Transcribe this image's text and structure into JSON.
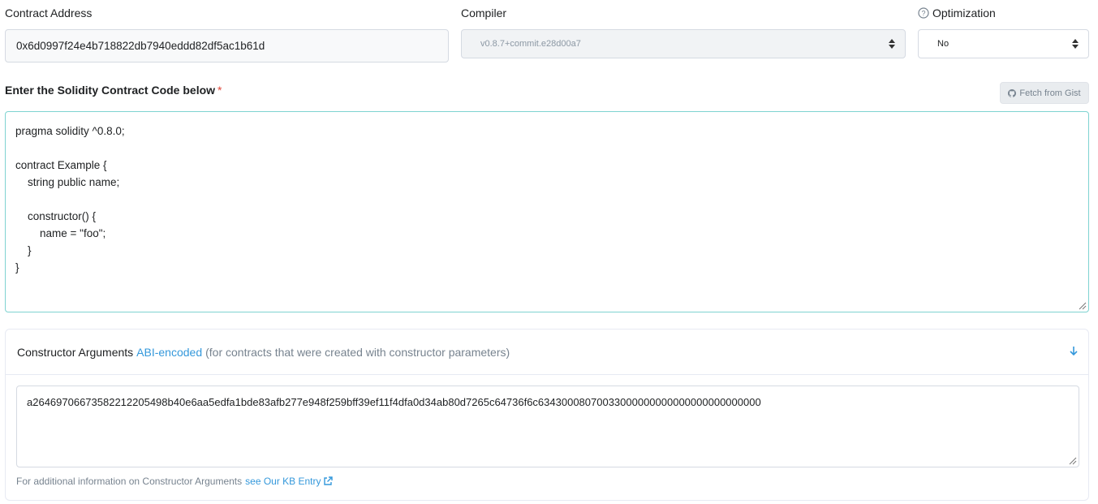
{
  "contract_address": {
    "label": "Contract Address",
    "value": "0x6d0997f24e4b718822db7940eddd82df5ac1b61d"
  },
  "compiler": {
    "label": "Compiler",
    "selected": "v0.8.7+commit.e28d00a7"
  },
  "optimization": {
    "label": "Optimization",
    "selected": "No"
  },
  "code_section": {
    "title": "Enter the Solidity Contract Code below",
    "required_marker": "*",
    "fetch_button_label": "Fetch from Gist",
    "code": "pragma solidity ^0.8.0;\n\ncontract Example {\n    string public name;\n\n    constructor() {\n        name = \"foo\";\n    }\n}"
  },
  "constructor_args": {
    "title": "Constructor Arguments",
    "link_text": "ABI-encoded",
    "hint": "(for contracts that were created with constructor parameters)",
    "value": "a264697066735822122054 98b40e6aa5edfa1bde83afb277e948f259bff39ef11f4dfa0d34ab80d7265c64736f6c63430008070033000000000000000000000000",
    "note_text": "For additional information on Constructor Arguments",
    "note_link": "see Our KB Entry"
  },
  "colors": {
    "accent": "#3498db",
    "required": "#de4437",
    "focus_border": "#7fd3d1"
  },
  "icons": {
    "help": "question-circle-icon",
    "github": "github-icon",
    "collapse": "arrow-down-icon",
    "external": "external-link-icon"
  }
}
